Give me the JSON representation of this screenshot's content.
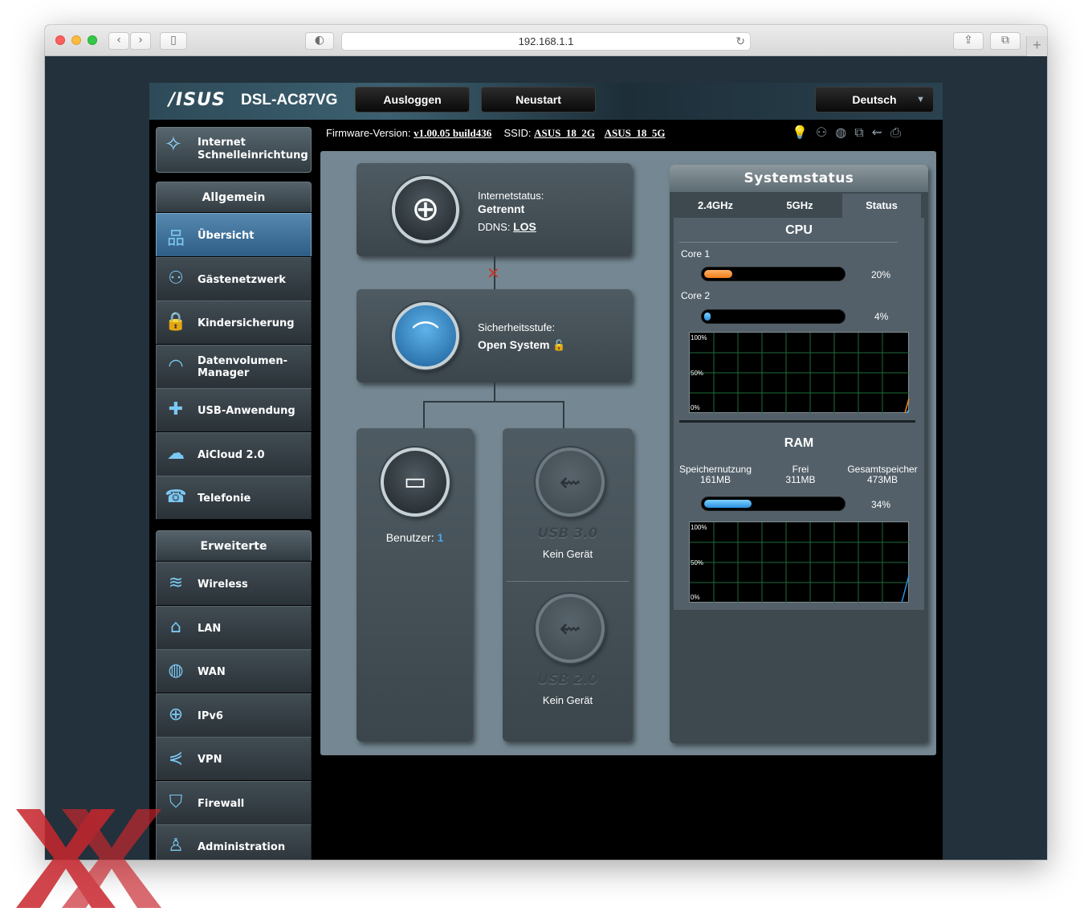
{
  "browser": {
    "url": "192.168.1.1"
  },
  "header": {
    "logo": "/ISUS",
    "model": "DSL-AC87VG",
    "logout_label": "Ausloggen",
    "reboot_label": "Neustart",
    "language_label": "Deutsch"
  },
  "info": {
    "firmware_label": "Firmware-Version:",
    "firmware_value": "v1.00.05 build436",
    "ssid_label": "SSID:",
    "ssid_2g": "ASUS_18_2G",
    "ssid_5g": "ASUS_18_5G"
  },
  "sidebar": {
    "qis_line1": "Internet",
    "qis_line2": "Schnelleinrichtung",
    "general_heading": "Allgemein",
    "general_items": [
      {
        "label": "Übersicht",
        "icon": "network-map-icon"
      },
      {
        "label": "Gästenetzwerk",
        "icon": "guest-network-icon"
      },
      {
        "label": "Kindersicherung",
        "icon": "parental-lock-icon"
      },
      {
        "label": "Datenvolumen-\nManager",
        "icon": "gauge-icon"
      },
      {
        "label": "USB-Anwendung",
        "icon": "puzzle-icon"
      },
      {
        "label": "AiCloud 2.0",
        "icon": "cloud-icon"
      },
      {
        "label": "Telefonie",
        "icon": "phone-icon"
      }
    ],
    "advanced_heading": "Erweiterte Einstellungen",
    "advanced_items": [
      {
        "label": "Wireless",
        "icon": "wifi-icon"
      },
      {
        "label": "LAN",
        "icon": "house-icon"
      },
      {
        "label": "WAN",
        "icon": "globe-icon"
      },
      {
        "label": "IPv6",
        "icon": "ipv6-icon"
      },
      {
        "label": "VPN",
        "icon": "vpn-icon"
      },
      {
        "label": "Firewall",
        "icon": "shield-icon"
      },
      {
        "label": "Administration",
        "icon": "admin-user-icon"
      }
    ]
  },
  "map": {
    "internet_status_label": "Internetstatus:",
    "internet_status_value": "Getrennt",
    "ddns_label": "DDNS:",
    "ddns_value": "LOS",
    "security_label": "Sicherheitsstufe:",
    "security_value": "Open System",
    "clients_label": "Benutzer:",
    "clients_value": "1",
    "usb30_label": "USB 3.0",
    "usb30_status": "Kein Gerät",
    "usb20_label": "USB 2.0",
    "usb20_status": "Kein Gerät"
  },
  "system_status": {
    "title": "Systemstatus",
    "tabs": [
      "2.4GHz",
      "5GHz",
      "Status"
    ],
    "active_tab": "Status",
    "cpu_title": "CPU",
    "cores": [
      {
        "label": "Core 1",
        "percent": 20,
        "percent_text": "20%",
        "color": "#f08a24"
      },
      {
        "label": "Core 2",
        "percent": 4,
        "percent_text": "4%",
        "color": "#4aa8ee"
      }
    ],
    "graph_labels": [
      "100%",
      "50%",
      "0%"
    ],
    "ram_title": "RAM",
    "ram_used_label": "Speichernutzung",
    "ram_used_value": "161MB",
    "ram_free_label": "Frei",
    "ram_free_value": "311MB",
    "ram_total_label": "Gesamtspeicher",
    "ram_total_value": "473MB",
    "ram_percent": 34,
    "ram_percent_text": "34%"
  },
  "colors": {
    "accent_blue": "#4aa8ee",
    "accent_orange": "#f08a24",
    "disconnected_red": "#c0392b",
    "watermark_red": "#c8262d"
  }
}
